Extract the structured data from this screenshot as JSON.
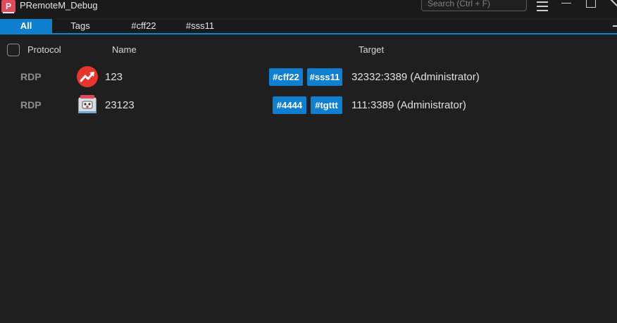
{
  "window": {
    "title": "PRemoteM_Debug",
    "app_icon_letter": "P"
  },
  "search": {
    "placeholder": "Search (Ctrl + F)",
    "value": ""
  },
  "tabs": [
    {
      "label": "All",
      "active": true
    },
    {
      "label": "Tags",
      "active": false
    },
    {
      "label": "#cff22",
      "active": false
    },
    {
      "label": "#sss11",
      "active": false
    }
  ],
  "table": {
    "headers": {
      "protocol": "Protocol",
      "name": "Name",
      "target": "Target"
    },
    "rows": [
      {
        "protocol": "RDP",
        "icon": "trending-up-icon",
        "name": "123",
        "tags": [
          "#cff22",
          "#sss11"
        ],
        "target": "32332:3389 (Administrator)"
      },
      {
        "protocol": "RDP",
        "icon": "robot-icon",
        "name": "23123",
        "tags": [
          "#4444",
          "#tgttt"
        ],
        "target": "111:3389 (Administrator)"
      }
    ]
  },
  "colors": {
    "accent": "#0f7fd0",
    "background": "#1f1f1f",
    "app_icon": "#e14a5d"
  }
}
